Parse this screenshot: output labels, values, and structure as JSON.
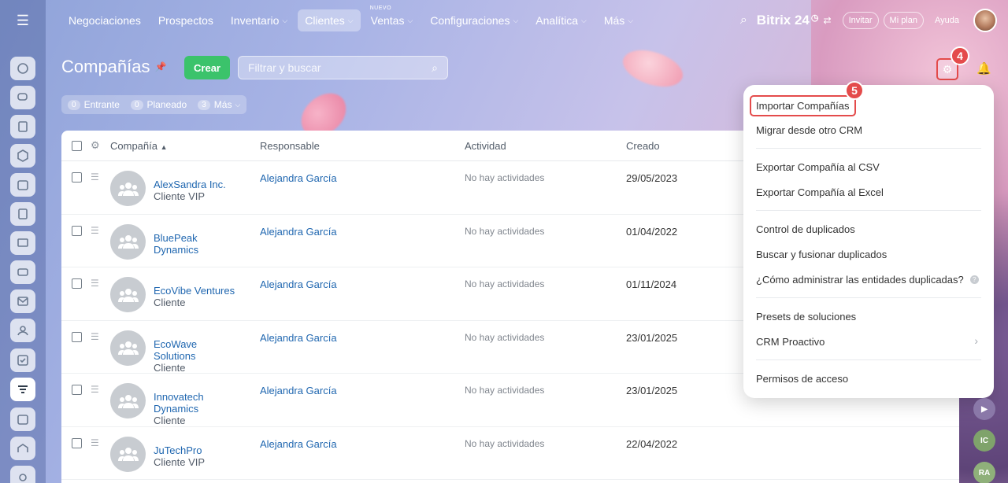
{
  "nav": {
    "items": [
      {
        "label": "Negociaciones",
        "has_chevron": false
      },
      {
        "label": "Prospectos",
        "has_chevron": false
      },
      {
        "label": "Inventario",
        "has_chevron": true
      },
      {
        "label": "Clientes",
        "has_chevron": true,
        "active": true
      },
      {
        "label": "Ventas",
        "has_chevron": true,
        "badge": "NUEVO"
      },
      {
        "label": "Configuraciones",
        "has_chevron": true
      },
      {
        "label": "Analítica",
        "has_chevron": true
      },
      {
        "label": "Más",
        "has_chevron": true
      }
    ],
    "logo": "Bitrix 24",
    "invite": "Invitar",
    "plan": "Mi plan",
    "help": "Ayuda"
  },
  "page": {
    "title": "Compañías",
    "create_label": "Crear",
    "filter_placeholder": "Filtrar y buscar",
    "counters": [
      {
        "num": "0",
        "label": "Entrante"
      },
      {
        "num": "0",
        "label": "Planeado"
      },
      {
        "num": "3",
        "label": "Más"
      }
    ]
  },
  "steps": {
    "gear": "4",
    "import": "5"
  },
  "table": {
    "headers": {
      "company": "Compañía",
      "responsible": "Responsable",
      "activity": "Actividad",
      "created": "Creado"
    },
    "rows": [
      {
        "name_lines": [
          "AlexSandra Inc."
        ],
        "type": "Cliente VIP",
        "responsible": "Alejandra García",
        "activity": "No hay actividades",
        "created": "29/05/2023"
      },
      {
        "name_lines": [
          "BluePeak",
          "Dynamics"
        ],
        "type": "",
        "responsible": "Alejandra García",
        "activity": "No hay actividades",
        "created": "01/04/2022"
      },
      {
        "name_lines": [
          "EcoVibe Ventures"
        ],
        "type": "Cliente",
        "responsible": "Alejandra García",
        "activity": "No hay actividades",
        "created": "01/11/2024"
      },
      {
        "name_lines": [
          "EcoWave",
          "Solutions"
        ],
        "type": "Cliente",
        "responsible": "Alejandra García",
        "activity": "No hay actividades",
        "created": "23/01/2025"
      },
      {
        "name_lines": [
          "Innovatech",
          "Dynamics"
        ],
        "type": "Cliente",
        "responsible": "Alejandra García",
        "activity": "No hay actividades",
        "created": "23/01/2025"
      },
      {
        "name_lines": [
          "JuTechPro"
        ],
        "type": "Cliente VIP",
        "responsible": "Alejandra García",
        "activity": "No hay actividades",
        "created": "22/04/2022"
      }
    ]
  },
  "menu": {
    "import": "Importar Compañías",
    "migrate": "Migrar desde otro CRM",
    "export_csv": "Exportar Compañía al CSV",
    "export_excel": "Exportar Compañía al Excel",
    "dup_control": "Control de duplicados",
    "dup_merge": "Buscar y fusionar duplicados",
    "dup_help": "¿Cómo administrar las entidades duplicadas?",
    "presets": "Presets de soluciones",
    "proactive": "CRM Proactivo",
    "permissions": "Permisos de acceso"
  },
  "bubbles": {
    "ic": "IC",
    "ra": "RA"
  },
  "colors": {
    "accent_green": "#3bc36b",
    "highlight_red": "#e44b4b",
    "link_blue": "#2067b0"
  }
}
